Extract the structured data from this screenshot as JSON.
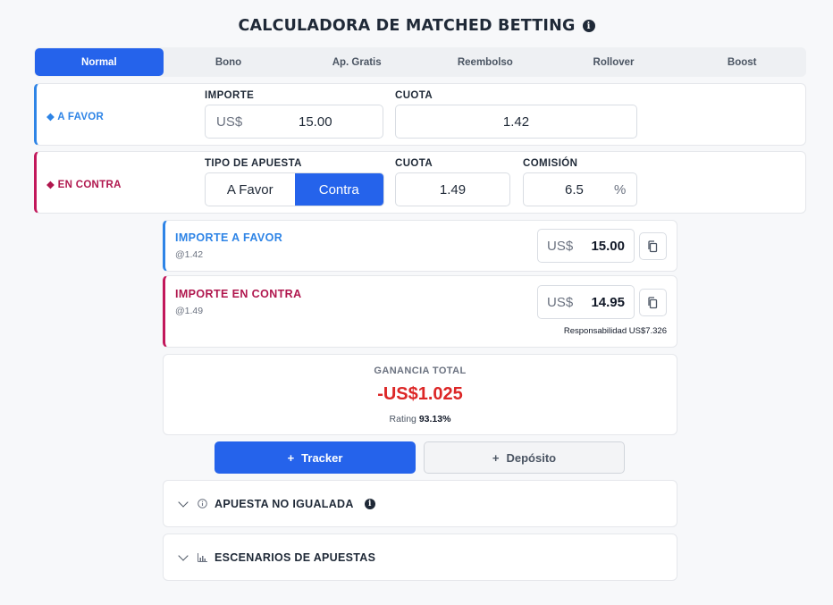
{
  "header": {
    "title": "CALCULADORA DE MATCHED BETTING",
    "info_icon": "i"
  },
  "tabs": [
    {
      "label": "Normal",
      "active": true
    },
    {
      "label": "Bono",
      "active": false
    },
    {
      "label": "Ap. Gratis",
      "active": false
    },
    {
      "label": "Reembolso",
      "active": false
    },
    {
      "label": "Rollover",
      "active": false
    },
    {
      "label": "Boost",
      "active": false
    }
  ],
  "favor": {
    "label": "◆ A FAVOR",
    "importe_label": "IMPORTE",
    "currency": "US$",
    "importe_value": "15.00",
    "cuota_label": "CUOTA",
    "cuota_value": "1.42"
  },
  "contra": {
    "label": "◆ EN CONTRA",
    "tipo_label": "TIPO DE APUESTA",
    "tipo_options": [
      "A Favor",
      "Contra"
    ],
    "tipo_selected": "Contra",
    "cuota_label": "CUOTA",
    "cuota_value": "1.49",
    "comision_label": "COMISIÓN",
    "comision_value": "6.5",
    "comision_unit": "%"
  },
  "results": {
    "favor": {
      "title": "IMPORTE A FAVOR",
      "sub": "@1.42",
      "currency": "US$",
      "value": "15.00"
    },
    "contra": {
      "title": "IMPORTE EN CONTRA",
      "sub": "@1.49",
      "currency": "US$",
      "value": "14.95",
      "responsabilidad": "Responsabilidad US$7.326"
    }
  },
  "total": {
    "label": "GANANCIA TOTAL",
    "value": "-US$1.025",
    "rating_label": "Rating",
    "rating_value": "93.13%"
  },
  "buttons": {
    "tracker": "Tracker",
    "deposito": "Depósito"
  },
  "accordions": {
    "no_igualada": "APUESTA NO IGUALADA",
    "escenarios": "ESCENARIOS DE APUESTAS"
  },
  "colors": {
    "primary": "#2563eb",
    "favor": "#2e84e6",
    "contra": "#b0174e",
    "negative": "#dc2626"
  }
}
